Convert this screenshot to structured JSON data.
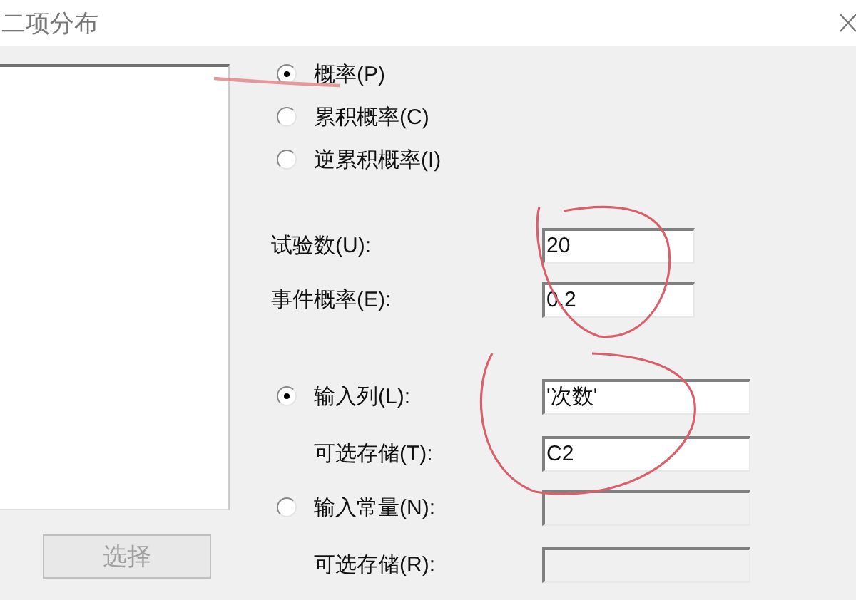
{
  "window": {
    "title": "二项分布"
  },
  "modes": [
    {
      "label": "概率(P)",
      "selected": true
    },
    {
      "label": "累积概率(C)",
      "selected": false
    },
    {
      "label": "逆累积概率(I)",
      "selected": false
    }
  ],
  "trials": {
    "label": "试验数(U):",
    "value": "20"
  },
  "event_probability": {
    "label": "事件概率(E):",
    "value": "0.2"
  },
  "inputs": [
    {
      "label": "输入列(L):",
      "selected": true,
      "value": "'次数'",
      "disabled": false,
      "store_label": "可选存储(T):",
      "store_value": "C2"
    },
    {
      "label": "输入常量(N):",
      "selected": false,
      "disabled": true,
      "store_label": "可选存储(R):"
    }
  ],
  "select_button": {
    "label": "选择",
    "disabled": true
  }
}
